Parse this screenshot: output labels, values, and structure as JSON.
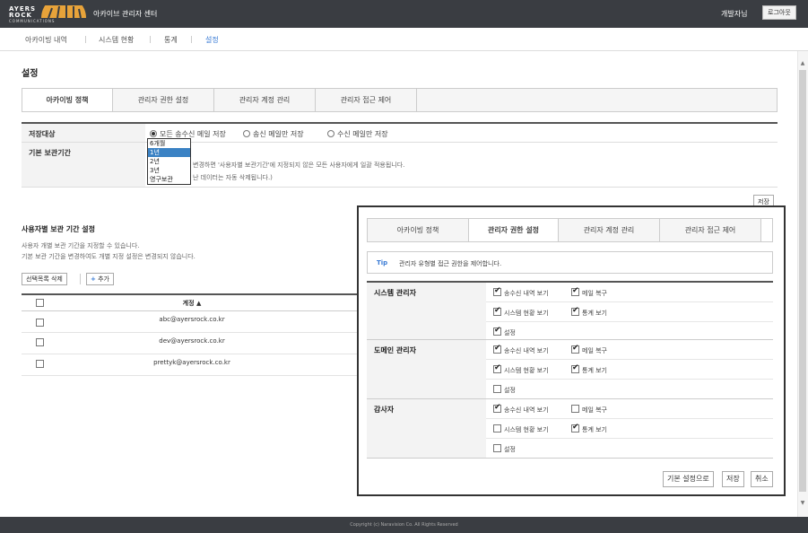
{
  "header": {
    "logo_line1": "AYERS",
    "logo_line2": "ROCK",
    "logo_sub": "COMMUNICATIONS",
    "app_title": "아카이브 관리자 센터",
    "user_name": "개발자님",
    "logout_label": "로그아웃"
  },
  "menu": [
    "아카이빙 내역",
    "시스템 현황",
    "통계",
    "설정"
  ],
  "page_title": "설정",
  "tabs": [
    "아카이빙 정책",
    "관리자 권한 설정",
    "관리자 계정 관리",
    "관리자 접근 제어"
  ],
  "storage": {
    "label": "저장대상",
    "options": [
      "모든 송수신 메일 저장",
      "송신 메일만 저장",
      "수신 메일만 저장"
    ],
    "selected": 0
  },
  "retention": {
    "label": "기본 보관기간",
    "hint1": "변경하면 '사용자별 보관기간'에 지정되지 않은 모든 사용자에게 일괄 적용됩니다.",
    "hint2": "난 데이터는 자동 삭제됩니다.)",
    "options": [
      "6개월",
      "1년",
      "2년",
      "3년",
      "영구보관"
    ],
    "selected": 1
  },
  "save_label": "저장",
  "user_section": {
    "title": "사용자별 보관 기간 설정",
    "desc1": "사용자 개별 보관 기간을 지정할 수 있습니다.",
    "desc2": "기본 보관 기간을 변경하여도 개별 지정 설정은 변경되지 않습니다.",
    "delete_label": "선택목록 삭제",
    "add_label": "추가",
    "add_plus": "+",
    "col_account": "계정 ▲",
    "rows": [
      "abc@ayersrock.co.kr",
      "dev@ayersrock.co.kr",
      "prettyk@ayersrock.co.kr"
    ]
  },
  "popup": {
    "tabs": [
      "아카이빙 정책",
      "관리자 권한 설정",
      "관리자 계정 관리",
      "관리자 접근 제어"
    ],
    "tip_label": "Tip",
    "tip_text": "관리자 유형별 접근 권한을 제어합니다.",
    "groups": [
      {
        "name": "시스템 관리자",
        "items": [
          {
            "label": "송수신 내역 보기",
            "checked": true
          },
          {
            "label": "메일 복구",
            "checked": true
          },
          {
            "label": "시스템 현황 보기",
            "checked": true
          },
          {
            "label": "통계 보기",
            "checked": true
          },
          {
            "label": "설정",
            "checked": true
          }
        ]
      },
      {
        "name": "도메인 관리자",
        "items": [
          {
            "label": "송수신 내역 보기",
            "checked": true
          },
          {
            "label": "메일 복구",
            "checked": true
          },
          {
            "label": "시스템 현황 보기",
            "checked": true
          },
          {
            "label": "통계 보기",
            "checked": true
          },
          {
            "label": "설정",
            "checked": false
          }
        ]
      },
      {
        "name": "감사자",
        "items": [
          {
            "label": "송수신 내역 보기",
            "checked": true
          },
          {
            "label": "메일 복구",
            "checked": false
          },
          {
            "label": "시스템 현황 보기",
            "checked": false
          },
          {
            "label": "통계 보기",
            "checked": true
          },
          {
            "label": "설정",
            "checked": false
          }
        ]
      }
    ],
    "btn_default": "기본 설정으로",
    "btn_save": "저장",
    "btn_cancel": "취소"
  },
  "footer": "Copyright (c) Naravision Co. All Rights Reserved",
  "colors": {
    "topbar": "#3a3d42",
    "accent": "#3a7bd5",
    "selected_option": "#3b82c4"
  }
}
